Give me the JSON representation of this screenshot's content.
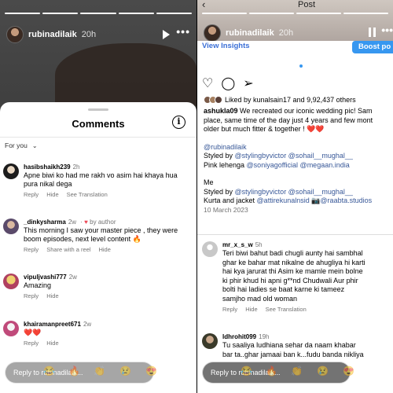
{
  "left_story": {
    "username": "rubinadilaik",
    "time": "20h",
    "comments_sheet": {
      "title": "Comments",
      "filter": "For you",
      "comments": [
        {
          "user": "hasibshaikh239",
          "time": "2h",
          "text": "Apne biwi ko had me rakh vo asim hai khaya hua pura nikal dega",
          "actions": [
            "Reply",
            "Hide",
            "See Translation"
          ]
        },
        {
          "user": "_dinkysharma",
          "time": "2w",
          "by_author": "by author",
          "text": "This morning I saw your master piece , they were  boom episodes, next level content 🔥",
          "actions": [
            "Reply",
            "Share with a reel",
            "Hide"
          ]
        },
        {
          "user": "vipuljvashi777",
          "time": "2w",
          "text": "Amazing",
          "actions": [
            "Reply",
            "Hide"
          ]
        },
        {
          "user": "khairamanpreet671",
          "time": "2w",
          "text": "❤️❤️",
          "actions": [
            "Reply",
            "Hide"
          ]
        }
      ]
    },
    "reply_placeholder": "Reply to rubinadilaik..."
  },
  "right_story": {
    "header_title": "Post",
    "username": "rubinadilaik",
    "time": "20h",
    "view_insights": "View Insights",
    "boost_label": "Boost po",
    "liked_by": "Liked by kunalsain17 and 9,92,437 others",
    "caption": {
      "user": "ashukla09",
      "line1": " We recreated our iconic wedding pic! Sam",
      "line2": "place, same time of the day just 4 years and few mont",
      "line3": "older but much fitter & together ! ❤️❤️",
      "mention": "@rubinadilaik",
      "styled1_prefix": "Styled by ",
      "styled1_links": "@stylingbyvictor @sohail__mughal__",
      "lehenga_prefix": "Pink lehenga ",
      "lehenga_links": "@soniyagofficial @megaan.india",
      "me": "Me",
      "styled2_prefix": "Styled by ",
      "styled2_links": "@stylingbyvictor @sohail__mughal__",
      "kurta_prefix": "Kurta and jacket ",
      "kurta_links": "@attirekunalnsid 📷@raabta.studios",
      "date": "10 March 2023"
    },
    "comments": [
      {
        "user": "mr_x_s_w",
        "time": "5h",
        "text": [
          "Teri biwi bahut badi chugli aunty hai sambhal",
          "ghar ke bahar mat nikalne de ahugliya hi karti",
          "hai kya jarurat thi Asim ke mamle mein bolne",
          "ki phir khud hi apni g**nd Chudwali Aur phir",
          "bolti hai ladies se baat karne ki tameez",
          "samjho mad old woman"
        ],
        "actions": [
          "Reply",
          "Hide",
          "See Translation"
        ]
      },
      {
        "user": "ldhrohit099",
        "time": "19h",
        "text": [
          "Tu saaliya  ludhiana sehar da naam khabar",
          "bar ta..ghar jamaai ban k...fudu banda nikliya"
        ]
      }
    ],
    "reply_placeholder": "Reply to rubinadilaik..."
  }
}
